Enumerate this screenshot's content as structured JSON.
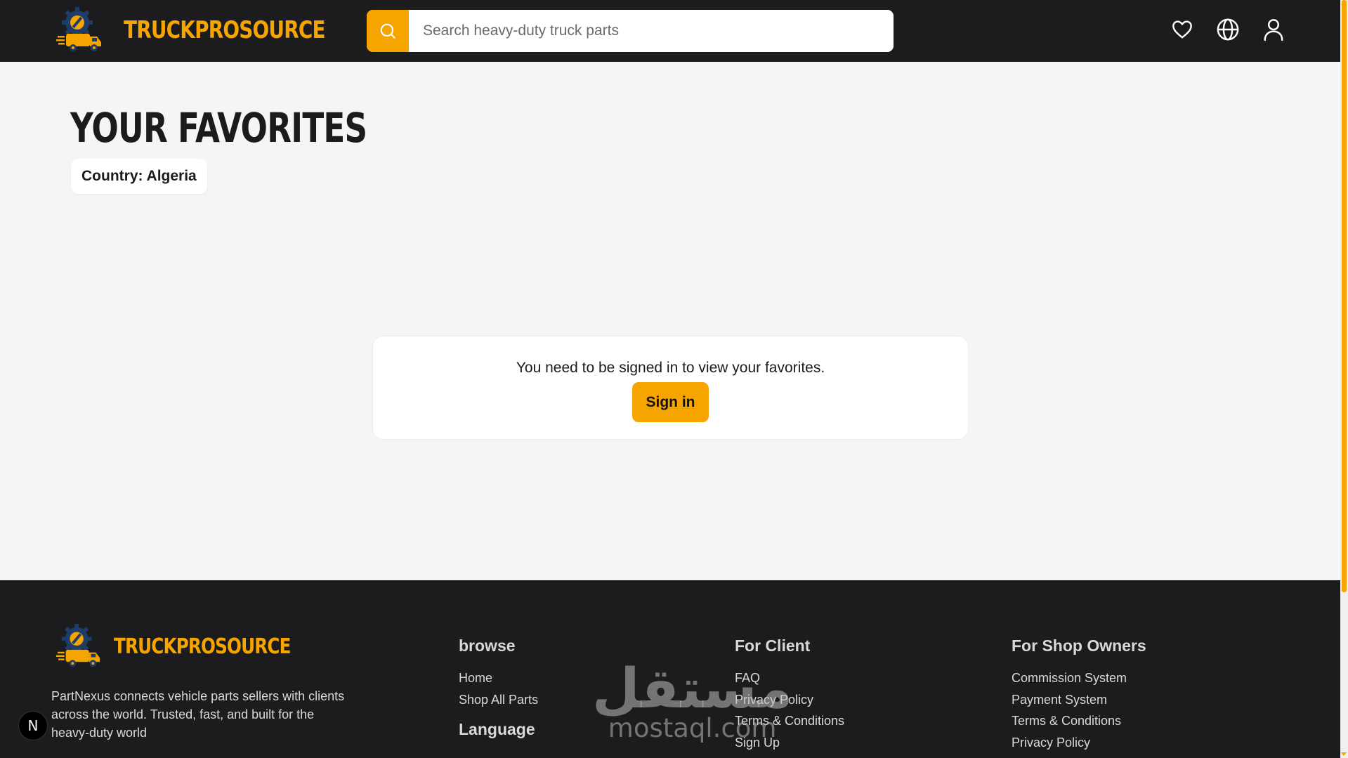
{
  "header": {
    "brand_name": "TRUCKPROSOURCE",
    "search_placeholder": "Search heavy-duty truck parts",
    "icons": [
      "heart-icon",
      "globe-icon",
      "user-icon"
    ]
  },
  "main": {
    "title": "YOUR FAVORITES",
    "country_label": "Country: Algeria",
    "signin_message": "You need to be signed in to view your favorites.",
    "signin_button": "Sign in"
  },
  "footer": {
    "brand_name": "TRUCKPROSOURCE",
    "description": "PartNexus connects vehicle parts sellers with clients across the world. Trusted, fast, and built for the heavy-duty world",
    "browse": {
      "heading": "browse",
      "links": [
        "Home",
        "Shop All Parts"
      ],
      "language_heading": "Language"
    },
    "client": {
      "heading": "For Client",
      "links": [
        "FAQ",
        "Privacy Policy",
        "Terms & Conditions",
        "Sign Up"
      ]
    },
    "shop_owners": {
      "heading": "For Shop Owners",
      "links": [
        "Commission System",
        "Payment System",
        "Terms & Conditions",
        "Privacy Policy"
      ]
    }
  },
  "watermark": {
    "arabic": "مستقل",
    "latin": "mostaql.com"
  },
  "dev_badge": "N",
  "colors": {
    "accent": "#f5a400",
    "dark": "#1c1c1e",
    "page_bg": "#f5f5f5"
  }
}
